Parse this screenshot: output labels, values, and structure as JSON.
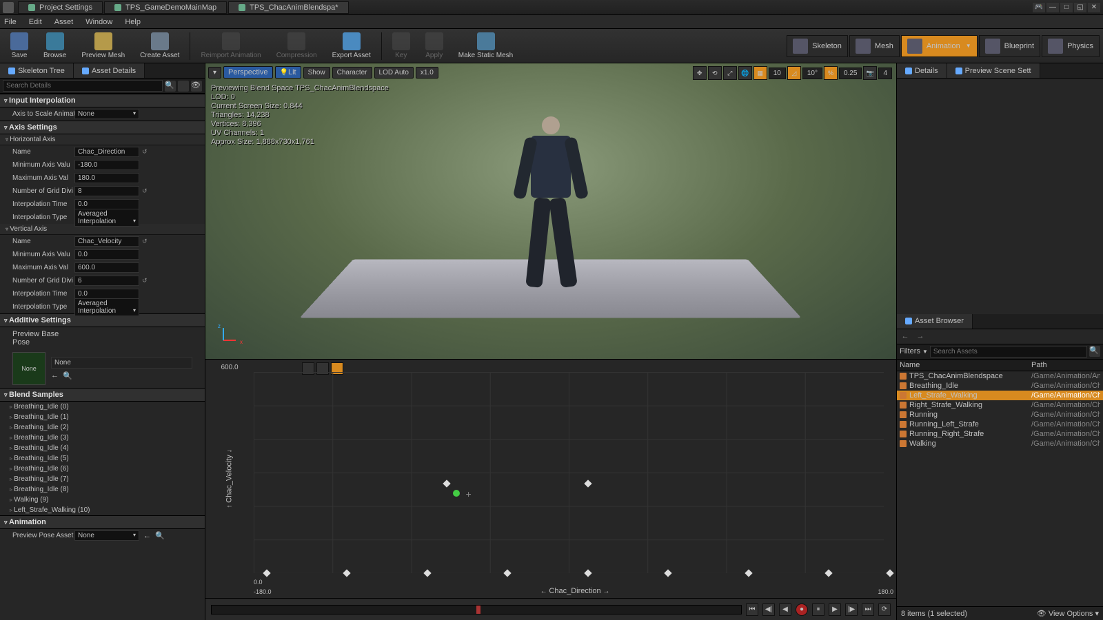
{
  "titlebar": {
    "tabs": [
      {
        "label": "Project Settings"
      },
      {
        "label": "TPS_GameDemoMainMap"
      },
      {
        "label": "TPS_ChacAnimBlendspa*"
      }
    ]
  },
  "menubar": {
    "file": "File",
    "edit": "Edit",
    "asset": "Asset",
    "window": "Window",
    "help": "Help"
  },
  "toolbar": {
    "save": "Save",
    "browse": "Browse",
    "preview_mesh": "Preview Mesh",
    "create_asset": "Create Asset",
    "reimport": "Reimport Animation",
    "compression": "Compression",
    "export": "Export Asset",
    "key": "Key",
    "apply": "Apply",
    "make_static": "Make Static Mesh",
    "skeleton": "Skeleton",
    "mesh": "Mesh",
    "animation": "Animation",
    "blueprint": "Blueprint",
    "physics": "Physics"
  },
  "left": {
    "tab_skeleton": "Skeleton Tree",
    "tab_details": "Asset Details",
    "search_placeholder": "Search Details",
    "sec_input": "Input Interpolation",
    "axis_scale_label": "Axis to Scale Animati",
    "axis_scale_value": "None",
    "sec_axis": "Axis Settings",
    "sub_horiz": "Horizontal Axis",
    "h_name_l": "Name",
    "h_name_v": "Chac_Direction",
    "h_min_l": "Minimum Axis Valu",
    "h_min_v": "-180.0",
    "h_max_l": "Maximum Axis Val",
    "h_max_v": "180.0",
    "h_div_l": "Number of Grid Divi",
    "h_div_v": "8",
    "h_time_l": "Interpolation Time",
    "h_time_v": "0.0",
    "h_type_l": "Interpolation Type",
    "h_type_v": "Averaged Interpolation",
    "sub_vert": "Vertical Axis",
    "v_name_l": "Name",
    "v_name_v": "Chac_Velocity",
    "v_min_l": "Minimum Axis Valu",
    "v_min_v": "0.0",
    "v_max_l": "Maximum Axis Val",
    "v_max_v": "600.0",
    "v_div_l": "Number of Grid Divi",
    "v_div_v": "6",
    "v_time_l": "Interpolation Time",
    "v_time_v": "0.0",
    "v_type_l": "Interpolation Type",
    "v_type_v": "Averaged Interpolation",
    "sec_additive": "Additive Settings",
    "prev_base_l": "Preview Base Pose",
    "prev_base_v": "None",
    "prev_base_thumb": "None",
    "sec_blend": "Blend Samples",
    "samples": [
      "Breathing_Idle (0)",
      "Breathing_Idle (1)",
      "Breathing_Idle (2)",
      "Breathing_Idle (3)",
      "Breathing_Idle (4)",
      "Breathing_Idle (5)",
      "Breathing_Idle (6)",
      "Breathing_Idle (7)",
      "Breathing_Idle (8)",
      "Walking (9)",
      "Left_Strafe_Walking (10)"
    ],
    "sec_anim": "Animation",
    "prev_pose_asset_l": "Preview Pose Asset",
    "prev_pose_asset_v": "None"
  },
  "viewport": {
    "persp": "Perspective",
    "lit": "Lit",
    "show": "Show",
    "character": "Character",
    "lod": "LOD Auto",
    "speed": "x1.0",
    "snap1": "10",
    "snap2": "10°",
    "snap3": "0.25",
    "cam": "4",
    "info": [
      "Previewing Blend Space TPS_ChacAnimBlendspace",
      "LOD: 0",
      "Current Screen Size: 0.844",
      "Triangles: 14,238",
      "Vertices: 8,396",
      "UV Channels: 1",
      "Approx Size: 1,888x730x1,761"
    ]
  },
  "bspace": {
    "ytop": "600.0",
    "ylabel": "Chac_Velocity",
    "xleft": "0.0",
    "xneg": "-180.0",
    "xright": "180.0",
    "xlabel": "Chac_Direction"
  },
  "right": {
    "tab_details": "Details",
    "tab_scene": "Preview Scene Sett",
    "tab_asset": "Asset Browser",
    "filters": "Filters",
    "search_placeholder": "Search Assets",
    "col_name": "Name",
    "col_path": "Path",
    "rows": [
      {
        "name": "TPS_ChacAnimBlendspace",
        "path": "/Game/Animation/Ani"
      },
      {
        "name": "Breathing_Idle",
        "path": "/Game/Animation/Cha"
      },
      {
        "name": "Left_Strafe_Walking",
        "path": "/Game/Animation/Cha",
        "sel": true
      },
      {
        "name": "Right_Strafe_Walking",
        "path": "/Game/Animation/Cha"
      },
      {
        "name": "Running",
        "path": "/Game/Animation/Cha"
      },
      {
        "name": "Running_Left_Strafe",
        "path": "/Game/Animation/Cha"
      },
      {
        "name": "Running_Right_Strafe",
        "path": "/Game/Animation/Cha"
      },
      {
        "name": "Walking",
        "path": "/Game/Animation/Cha"
      }
    ],
    "footer_count": "8 items (1 selected)",
    "footer_view": "View Options"
  }
}
